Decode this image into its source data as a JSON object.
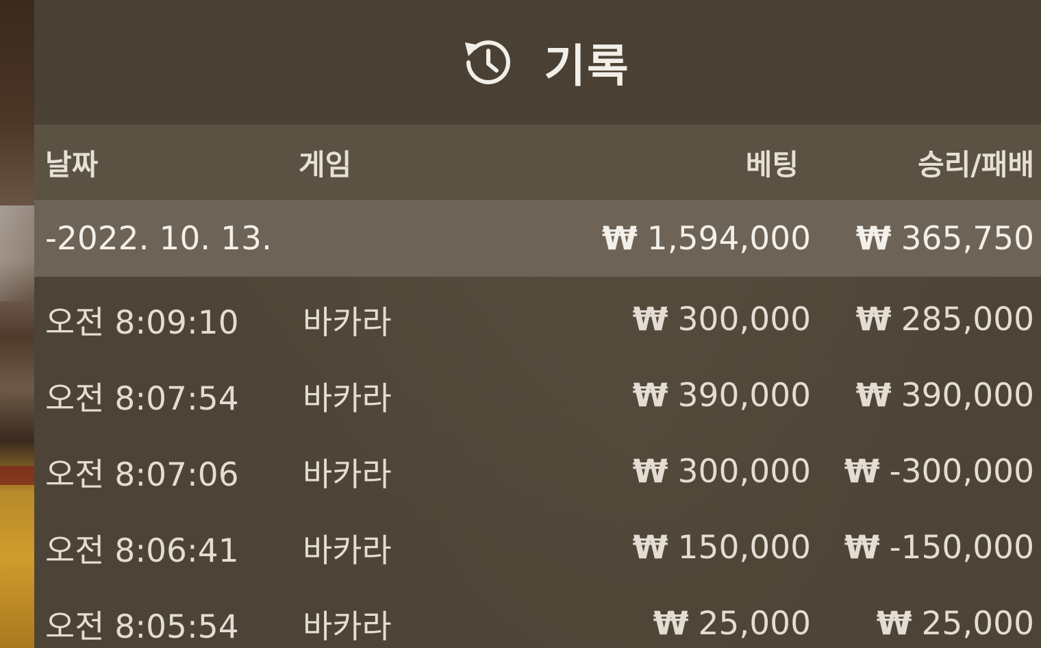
{
  "panel": {
    "title": "기록",
    "icon": "history-icon"
  },
  "columns": {
    "date": "날짜",
    "game": "게임",
    "bet": "베팅",
    "win_loss": "승리/패배"
  },
  "summary": {
    "date": "-2022. 10. 13.",
    "bet_currency": "₩",
    "bet_amount": "1,594,000",
    "win_currency": "₩",
    "win_amount": "365,750"
  },
  "rows": [
    {
      "time": "오전 8:09:10",
      "game": "바카라",
      "bet_currency": "₩",
      "bet": "300,000",
      "win_currency": "₩",
      "win": "285,000"
    },
    {
      "time": "오전 8:07:54",
      "game": "바카라",
      "bet_currency": "₩",
      "bet": "390,000",
      "win_currency": "₩",
      "win": "390,000"
    },
    {
      "time": "오전 8:07:06",
      "game": "바카라",
      "bet_currency": "₩",
      "bet": "300,000",
      "win_currency": "₩",
      "win": "-300,000"
    },
    {
      "time": "오전 8:06:41",
      "game": "바카라",
      "bet_currency": "₩",
      "bet": "150,000",
      "win_currency": "₩",
      "win": "-150,000"
    },
    {
      "time": "오전 8:05:54",
      "game": "바카라",
      "bet_currency": "₩",
      "bet": "25,000",
      "win_currency": "₩",
      "win": "25,000"
    }
  ],
  "colors": {
    "panel_bg": "#4d4437",
    "header_row_bg": "#5b5244",
    "summary_bg": "#6d6457",
    "text": "#ece7df"
  }
}
